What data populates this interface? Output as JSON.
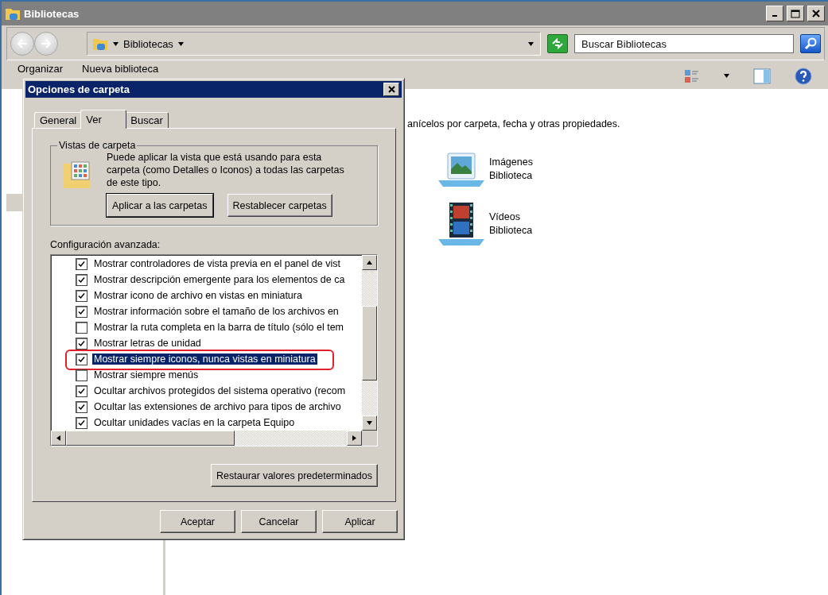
{
  "window": {
    "title": "Bibliotecas"
  },
  "address_bar": {
    "path": "Bibliotecas"
  },
  "search": {
    "placeholder": "Buscar Bibliotecas"
  },
  "toolbar": {
    "items": [
      "Organizar",
      "Nueva biblioteca"
    ]
  },
  "content": {
    "description": "anícelos por carpeta, fecha y otras propiedades.",
    "libraries": [
      {
        "name": "Imágenes",
        "type": "Biblioteca",
        "kind": "images"
      },
      {
        "name": "Vídeos",
        "type": "Biblioteca",
        "kind": "videos"
      }
    ]
  },
  "dialog": {
    "title": "Opciones de carpeta",
    "tabs": [
      {
        "label": "General",
        "selected": false
      },
      {
        "label": "Ver",
        "selected": true
      },
      {
        "label": "Buscar",
        "selected": false
      }
    ],
    "folder_views": {
      "legend": "Vistas de carpeta",
      "text": "Puede aplicar la vista que está usando para esta carpeta (como Detalles o Iconos) a todas las carpetas de este tipo.",
      "buttons": [
        "Aplicar a las carpetas",
        "Restablecer carpetas"
      ]
    },
    "advanced_label": "Configuración avanzada:",
    "settings": [
      {
        "label": "Mostrar controladores de vista previa en el panel de vist",
        "checked": true,
        "selected": false,
        "circled": false
      },
      {
        "label": "Mostrar descripción emergente para los elementos de ca",
        "checked": true,
        "selected": false,
        "circled": false
      },
      {
        "label": "Mostrar icono de archivo en vistas en miniatura",
        "checked": true,
        "selected": false,
        "circled": false
      },
      {
        "label": "Mostrar información sobre el tamaño de los archivos en",
        "checked": true,
        "selected": false,
        "circled": false
      },
      {
        "label": "Mostrar la ruta completa en la barra de título (sólo el tem",
        "checked": false,
        "selected": false,
        "circled": false
      },
      {
        "label": "Mostrar letras de unidad",
        "checked": true,
        "selected": false,
        "circled": false
      },
      {
        "label": "Mostrar siempre iconos, nunca vistas en miniatura",
        "checked": true,
        "selected": true,
        "circled": true
      },
      {
        "label": "Mostrar siempre menús",
        "checked": false,
        "selected": false,
        "circled": false
      },
      {
        "label": "Ocultar archivos protegidos del sistema operativo (recom",
        "checked": true,
        "selected": false,
        "circled": false
      },
      {
        "label": "Ocultar las extensiones de archivo para tipos de archivo",
        "checked": true,
        "selected": false,
        "circled": false
      },
      {
        "label": "Ocultar unidades vacías en la carpeta Equipo",
        "checked": true,
        "selected": false,
        "circled": false
      }
    ],
    "restore_button": "Restaurar valores predeterminados",
    "buttons": [
      "Aceptar",
      "Cancelar",
      "Aplicar"
    ]
  }
}
